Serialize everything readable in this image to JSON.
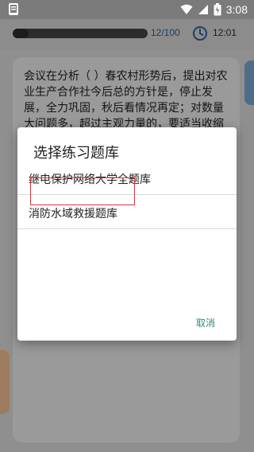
{
  "status_bar": {
    "time": "3:08",
    "icons": [
      "wifi-icon",
      "signal-icon",
      "battery-icon"
    ]
  },
  "quiz": {
    "progress_text": "12/100",
    "progress": 0.12,
    "timer": "12:01",
    "question": "会议在分析（ ）春农村形势后，提出对农业生产合作社今后总的方针是，停止发展，全力巩固，秋后看情况再定；对数量大问题多，超过主观力量的，要适当收缩一部分。"
  },
  "dialog": {
    "title": "选择练习题库",
    "items": [
      {
        "label": "继电保护网络大学全题库"
      },
      {
        "label": "消防水域救援题库"
      }
    ],
    "cancel_label": "取消"
  },
  "colors": {
    "accent": "#2d8c7c",
    "highlight": "#d9363e",
    "progress_text": "#1f3d66"
  }
}
